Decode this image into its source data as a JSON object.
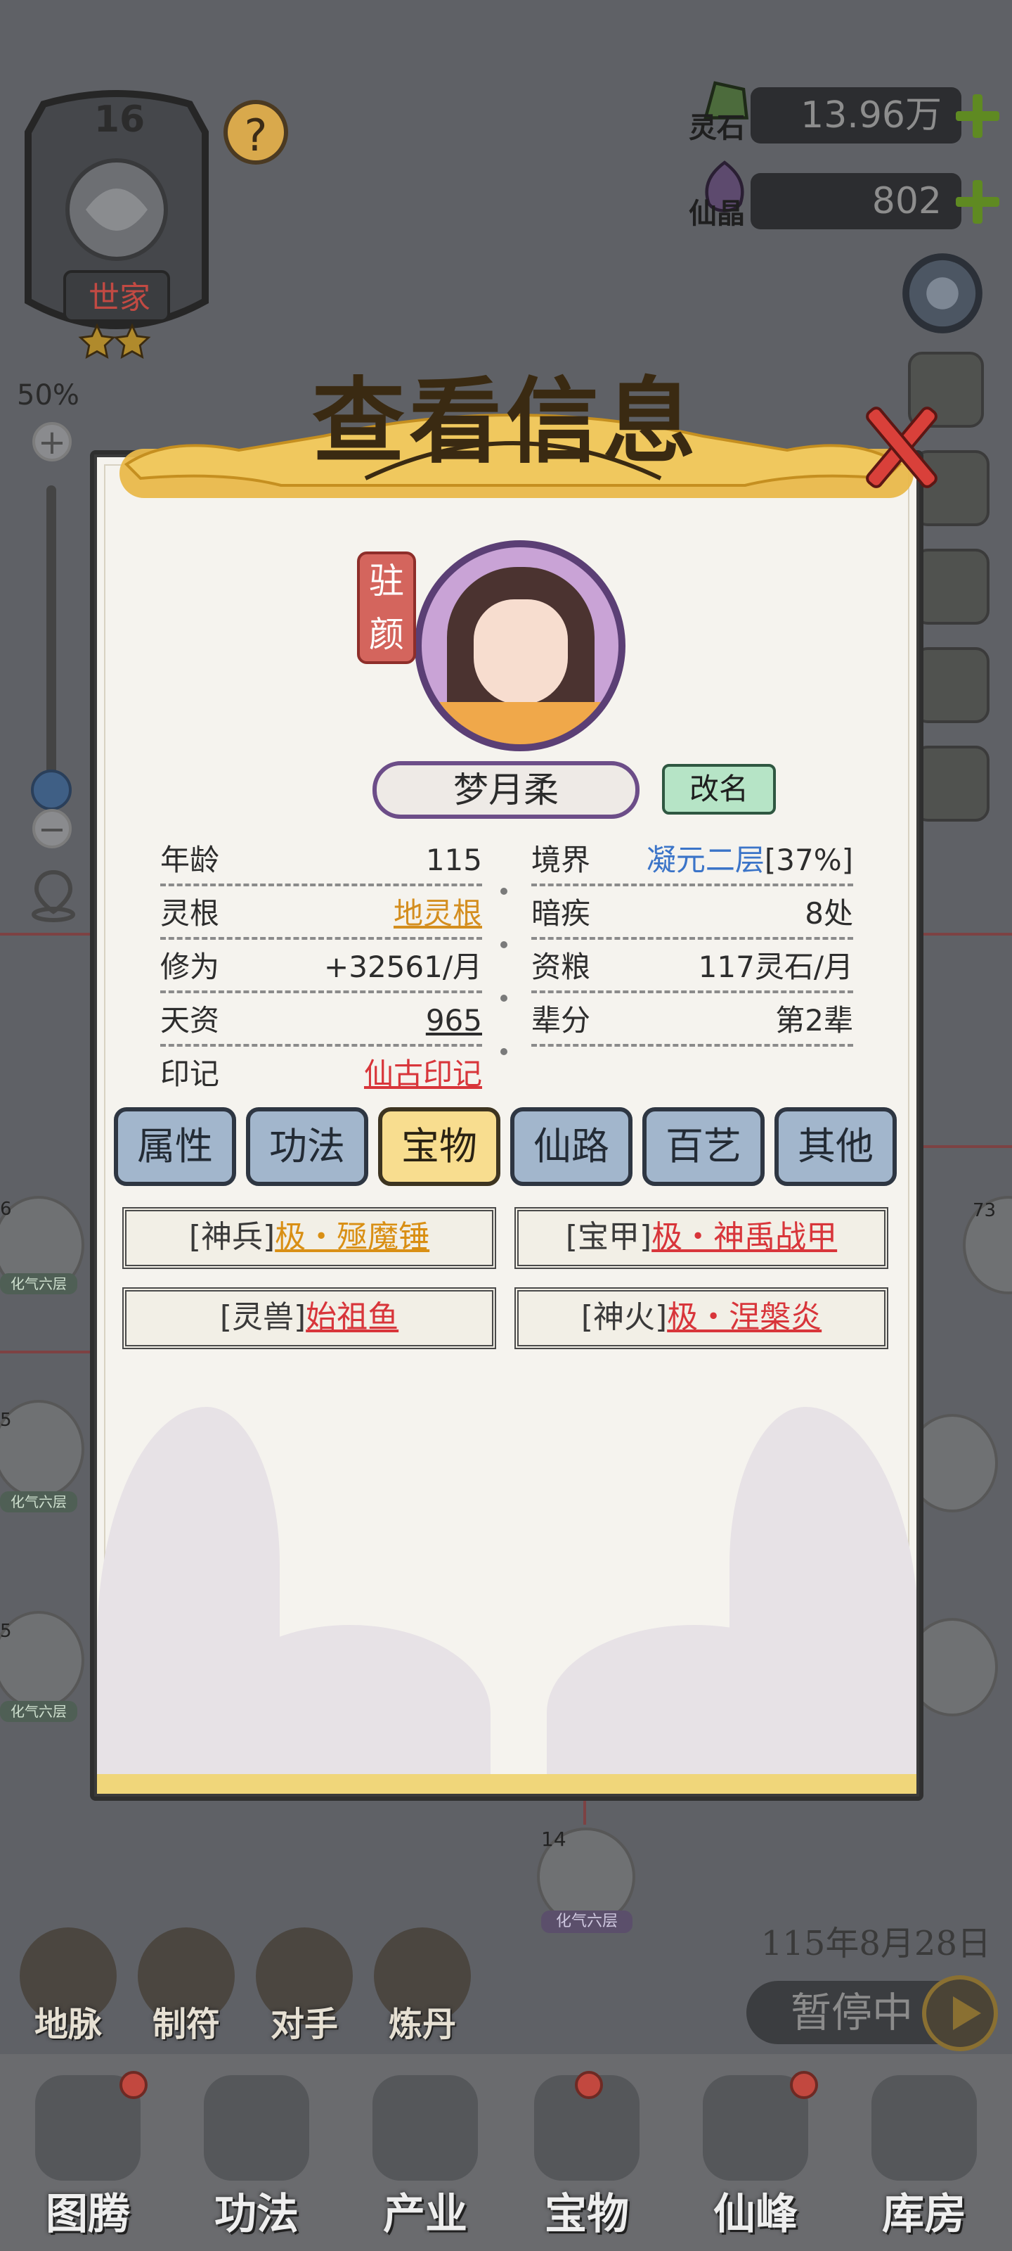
{
  "clan": {
    "level": "16",
    "rank": "世家",
    "stars": 2
  },
  "zoom": {
    "percent": "50%",
    "plus": "+",
    "minus": "−",
    "level": 0.5
  },
  "resources": [
    {
      "label": "灵石",
      "value": "13.96万"
    },
    {
      "label": "仙晶",
      "value": "802"
    }
  ],
  "modal": {
    "title": "查看信息",
    "seal": "驻颜",
    "name": "梦月柔",
    "rename": "改名",
    "info_left": [
      {
        "label": "年龄",
        "value": "115"
      },
      {
        "label": "灵根",
        "value": "地灵根"
      },
      {
        "label": "修为",
        "value": "+32561/月"
      },
      {
        "label": "天资",
        "value": "965"
      },
      {
        "label": "印记",
        "value": "仙古印记"
      }
    ],
    "info_right": [
      {
        "label": "境界",
        "value_main": "凝元二层",
        "value_extra": "[37%]"
      },
      {
        "label": "暗疾",
        "value": "8处"
      },
      {
        "label": "资粮",
        "value": "117灵石/月"
      },
      {
        "label": "辈分",
        "value": "第2辈"
      }
    ],
    "tabs": [
      "属性",
      "功法",
      "宝物",
      "仙路",
      "百艺",
      "其他"
    ],
    "active_tab": "宝物",
    "treasures": [
      {
        "prefix": "[神兵]",
        "item": "极・殛魔锤",
        "color": "#d98f14"
      },
      {
        "prefix": "[宝甲]",
        "item": "极・神禹战甲",
        "color": "#d8353a"
      },
      {
        "prefix": "[灵兽]",
        "item": "始祖鱼",
        "color": "#d8353a"
      },
      {
        "prefix": "[神火]",
        "item": "极・涅槃炎",
        "color": "#d8353a"
      }
    ]
  },
  "date": "115年8月28日",
  "pause": "暂停中",
  "tools": [
    "地脉",
    "制符",
    "对手",
    "炼丹"
  ],
  "nav": [
    "图腾",
    "功法",
    "产业",
    "宝物",
    "仙峰",
    "库房"
  ],
  "bg_avatars": [
    "6",
    "5",
    "5",
    "14",
    "73"
  ],
  "bg_avatar_tag": "化气六层",
  "colors": {
    "accent_gold": "#e9b84a",
    "tab_active": "#f8dd8f",
    "tab_normal": "#a2b6cc",
    "rename_bg": "#b6e4c6"
  }
}
